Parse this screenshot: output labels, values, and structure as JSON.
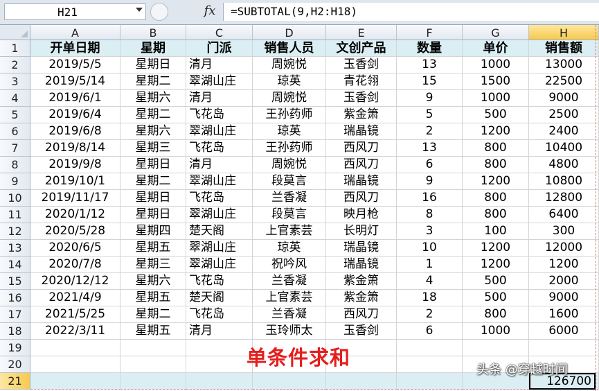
{
  "formula_bar": {
    "name_box": "H21",
    "fx_label": "fx",
    "formula": "=SUBTOTAL(9,H2:H18)"
  },
  "columns": [
    "A",
    "B",
    "C",
    "D",
    "E",
    "F",
    "G",
    "H"
  ],
  "header": [
    "开单日期",
    "星期",
    "门派",
    "销售人员",
    "文创产品",
    "数量",
    "单价",
    "销售额"
  ],
  "rows": [
    [
      "2019/5/5",
      "星期日",
      "清月",
      "周婉悦",
      "玉香剑",
      "13",
      "1000",
      "13000"
    ],
    [
      "2019/5/14",
      "星期二",
      "翠湖山庄",
      "琼英",
      "青花翎",
      "15",
      "1500",
      "22500"
    ],
    [
      "2019/6/1",
      "星期六",
      "清月",
      "周婉悦",
      "玉香剑",
      "9",
      "1000",
      "9000"
    ],
    [
      "2019/6/4",
      "星期二",
      "飞花岛",
      "王孙药师",
      "紫金箫",
      "5",
      "500",
      "2500"
    ],
    [
      "2019/6/8",
      "星期六",
      "翠湖山庄",
      "琼英",
      "瑞晶镜",
      "2",
      "1200",
      "2400"
    ],
    [
      "2019/8/14",
      "星期三",
      "飞花岛",
      "王孙药师",
      "西风刀",
      "13",
      "800",
      "10400"
    ],
    [
      "2019/9/8",
      "星期日",
      "清月",
      "周婉悦",
      "西风刀",
      "6",
      "800",
      "4800"
    ],
    [
      "2019/10/1",
      "星期二",
      "翠湖山庄",
      "段莫言",
      "瑞晶镜",
      "9",
      "1200",
      "10800"
    ],
    [
      "2019/11/17",
      "星期日",
      "飞花岛",
      "兰香凝",
      "西风刀",
      "16",
      "800",
      "12800"
    ],
    [
      "2020/1/12",
      "星期日",
      "翠湖山庄",
      "段莫言",
      "映月枪",
      "8",
      "800",
      "6400"
    ],
    [
      "2020/5/28",
      "星期四",
      "楚天阁",
      "上官素芸",
      "长明灯",
      "3",
      "100",
      "300"
    ],
    [
      "2020/6/5",
      "星期五",
      "翠湖山庄",
      "琼英",
      "瑞晶镜",
      "10",
      "1200",
      "12000"
    ],
    [
      "2020/7/8",
      "星期三",
      "翠湖山庄",
      "祝吟风",
      "瑞晶镜",
      "1",
      "1200",
      "1200"
    ],
    [
      "2020/12/12",
      "星期六",
      "飞花岛",
      "兰香凝",
      "紫金箫",
      "4",
      "500",
      "2000"
    ],
    [
      "2021/4/9",
      "星期五",
      "楚天阁",
      "上官素芸",
      "紫金箫",
      "18",
      "500",
      "9000"
    ],
    [
      "2021/5/25",
      "星期二",
      "飞花岛",
      "兰香凝",
      "西风刀",
      "2",
      "800",
      "1600"
    ],
    [
      "2022/3/11",
      "星期五",
      "清月",
      "玉玲师太",
      "玉香剑",
      "6",
      "1000",
      "6000"
    ]
  ],
  "row_numbers": [
    "1",
    "2",
    "3",
    "4",
    "5",
    "6",
    "7",
    "8",
    "9",
    "10",
    "11",
    "12",
    "13",
    "14",
    "15",
    "16",
    "17",
    "18",
    "19",
    "20",
    "21"
  ],
  "subtotal_value": "126700",
  "overlay_title": "单条件求和",
  "watermark": "头条 @穿越时间",
  "colors": {
    "title_red": "#e51d1d",
    "header_fill": "#dbeef3",
    "selected_header": "#f7c94e"
  }
}
